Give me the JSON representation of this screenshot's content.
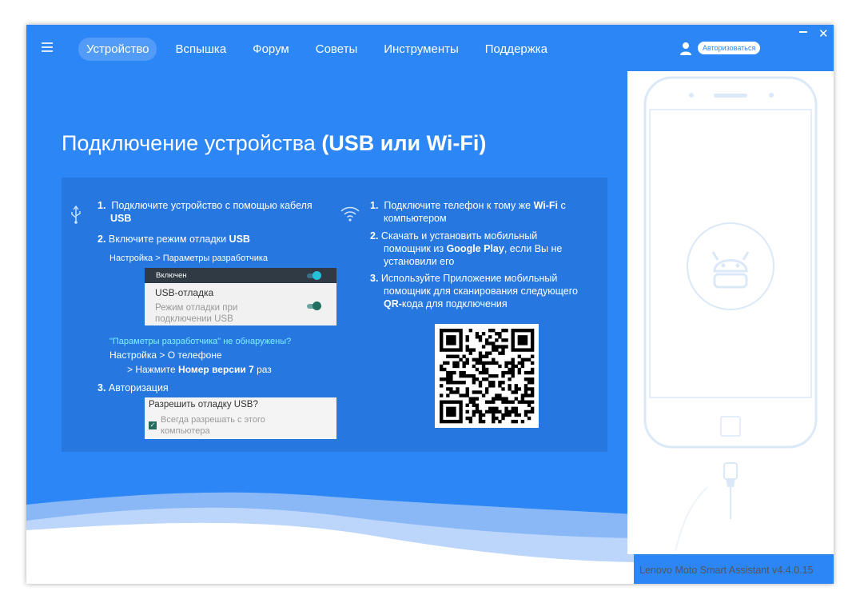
{
  "nav": {
    "items": [
      "Устройство",
      "Вспышка",
      "Форум",
      "Советы",
      "Инструменты",
      "Поддержка"
    ],
    "active_index": 0
  },
  "header": {
    "login_label": "Авторизоваться"
  },
  "main": {
    "heading_normal": "Подключение устройства ",
    "heading_bold": "(USB или Wi-Fi)"
  },
  "usb": {
    "step1_num": "1.",
    "step1_line1": "Подключите устройство с помощью кабеля",
    "step1_line2": "USB",
    "step2_num": "2.",
    "step2_text": "Включите режим отладки ",
    "step2_bold": "USB",
    "path": "Настройка > Параметры разработчика",
    "toggle_header": "Включен",
    "toggle_title": "USB-отладка",
    "toggle_sub1": "Режим отладки при",
    "toggle_sub2": "подключении USB",
    "not_found": "\"Параметры разработчика\" не обнаружены?",
    "settings_about": "Настройка > О телефоне",
    "press_prefix": "> Нажмите ",
    "press_bold": "Номер версии 7",
    "press_suffix": " раз",
    "step3_num": "3.",
    "step3_text": "Авторизация",
    "auth_title": "Разрешить отладку USB?",
    "auth_sub1": "Всегда разрешать с этого",
    "auth_sub2": "компьютера"
  },
  "wifi": {
    "step1_num": "1.",
    "step1_line1a": "Подключите телефон к тому же ",
    "step1_line1b": "Wi-Fi",
    "step1_line1c": " с",
    "step1_line2": "компьютером",
    "step2_num": "2.",
    "step2_line1": "Скачать и установить мобильный",
    "step2_line2a": "помощник из ",
    "step2_line2b": "Google Play",
    "step2_line2c": ", если Вы не",
    "step2_line3": "установили его",
    "step3_num": "3.",
    "step3_line1": "Используйте Приложение мобильный",
    "step3_line2": "помощник для сканирования следующего",
    "step3_line3a": "QR-",
    "step3_line3b": "кода для подключения"
  },
  "footer": {
    "version": "Lenovo Moto Smart Assistant v4.4.0.15"
  },
  "colors": {
    "accent": "#2c86f5",
    "panel": "#2677e0",
    "toggle_on": "#26a5c9",
    "link": "#7ef3ff"
  },
  "icons": [
    "menu-icon",
    "user-icon",
    "minimize-icon",
    "close-icon",
    "usb-icon",
    "wifi-icon",
    "android-icon",
    "usb-cable-icon"
  ]
}
